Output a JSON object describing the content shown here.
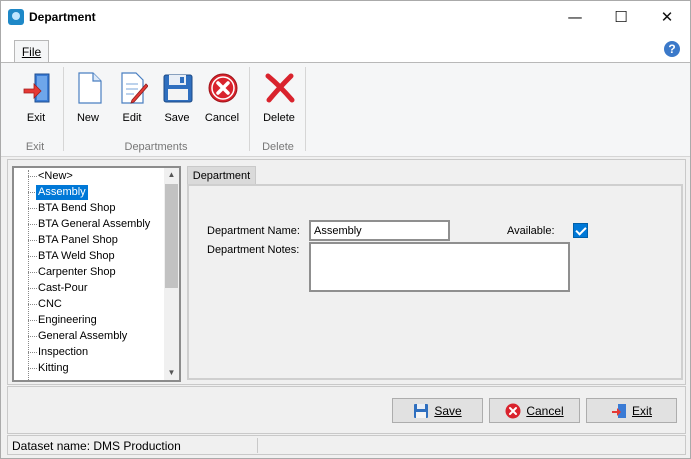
{
  "window": {
    "title": "Department"
  },
  "ribbon": {
    "tab_file": "File",
    "groups": [
      {
        "label": "Exit",
        "buttons": [
          "Exit"
        ]
      },
      {
        "label": "Departments",
        "buttons": [
          "New",
          "Edit",
          "Save",
          "Cancel"
        ]
      },
      {
        "label": "Delete",
        "buttons": [
          "Delete"
        ]
      }
    ]
  },
  "tree": {
    "items": [
      "<New>",
      "Assembly",
      "BTA Bend Shop",
      "BTA General Assembly",
      "BTA Panel Shop",
      "BTA Weld Shop",
      "Carpenter Shop",
      "Cast-Pour",
      "CNC",
      "Engineering",
      "General Assembly",
      "Inspection",
      "Kitting"
    ],
    "selected": "Assembly"
  },
  "detail": {
    "tab_label": "Department",
    "name_label": "Department Name:",
    "name_value": "Assembly",
    "available_label": "Available:",
    "available": true,
    "notes_label": "Department Notes:",
    "notes_value": ""
  },
  "footer": {
    "save_label": "Save",
    "cancel_label": "Cancel",
    "exit_label": "Exit"
  },
  "status": {
    "text": "Dataset name:  DMS Production"
  },
  "colors": {
    "accent": "#0078d7",
    "red_icon": "#d9232d",
    "blue_icon": "#2f6fbf"
  }
}
